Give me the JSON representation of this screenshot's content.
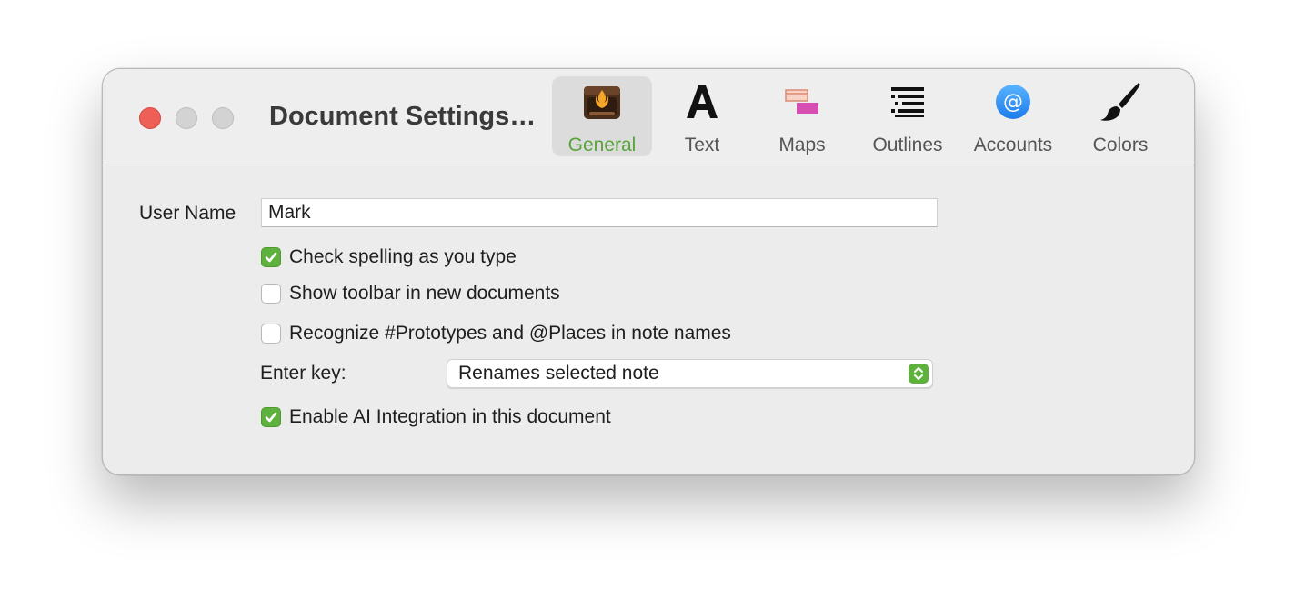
{
  "window": {
    "title": "Document Settings…",
    "controls": [
      "close-button",
      "minimize-button",
      "maximize-button"
    ]
  },
  "tabs": [
    {
      "label": "General",
      "icon": "tinderbox-app-icon",
      "active": true
    },
    {
      "label": "Text",
      "icon": "letter-a-icon",
      "active": false
    },
    {
      "label": "Maps",
      "icon": "map-notes-icon",
      "active": false
    },
    {
      "label": "Outlines",
      "icon": "outline-list-icon",
      "active": false
    },
    {
      "label": "Accounts",
      "icon": "at-sign-icon",
      "active": false
    },
    {
      "label": "Colors",
      "icon": "paintbrush-icon",
      "active": false
    }
  ],
  "general": {
    "user_name_label": "User Name",
    "user_name_value": "Mark",
    "check_spelling": {
      "label": "Check spelling as you type",
      "checked": true
    },
    "show_toolbar": {
      "label": "Show toolbar in new documents",
      "checked": false
    },
    "recognize_prototypes": {
      "label": "Recognize #Prototypes and @Places in note names",
      "checked": false
    },
    "enter_key_label": "Enter key:",
    "enter_key_value": "Renames selected note",
    "enable_ai": {
      "label": "Enable AI Integration in this document",
      "checked": true
    }
  },
  "colors": {
    "accent": "#5fb13d",
    "active_tab_label": "#5aa33c",
    "close": "#ee5f57",
    "inactive_control": "#d3d3d3"
  }
}
